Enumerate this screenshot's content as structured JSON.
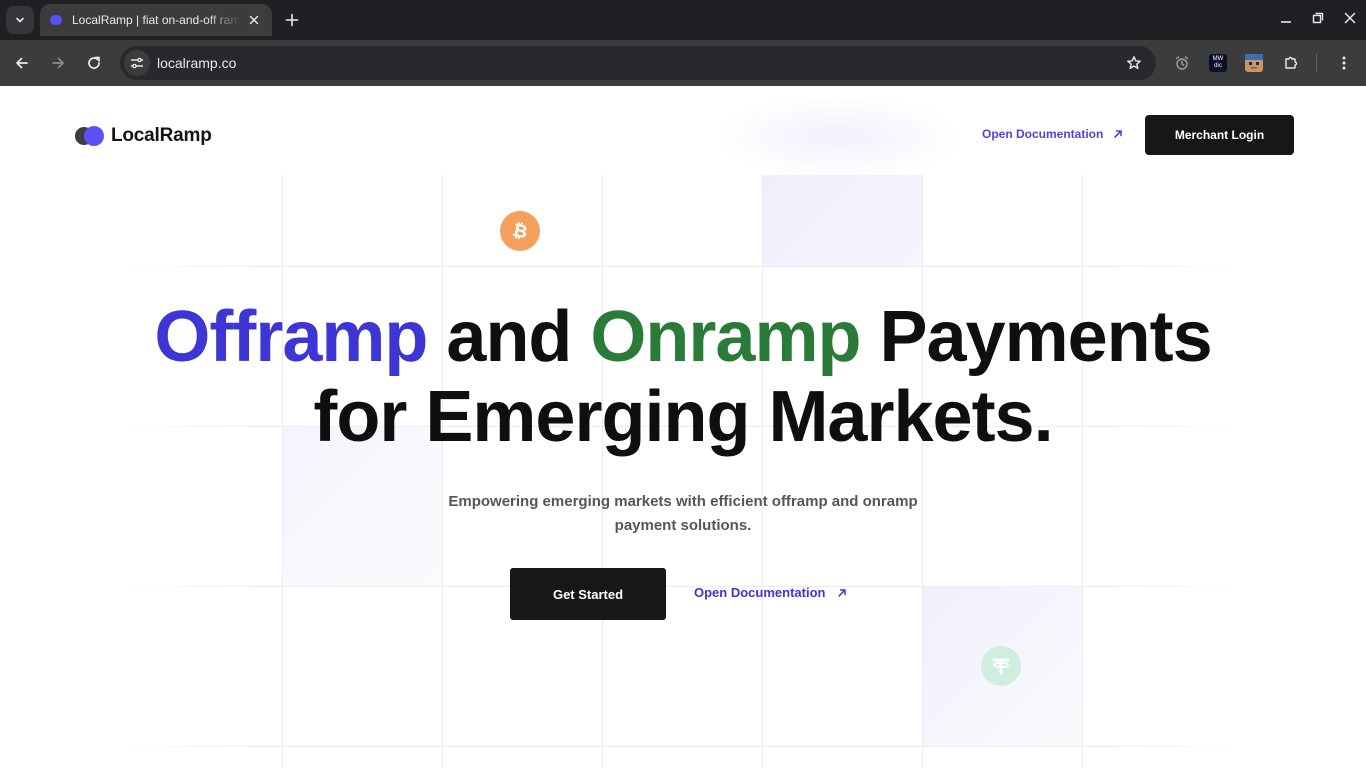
{
  "browser": {
    "tab_title": "LocalRamp | fiat on-and-off ramp",
    "url": "localramp.co",
    "extension_badge": [
      "MW",
      "dic"
    ]
  },
  "nav": {
    "brand": "LocalRamp",
    "doc_link": "Open Documentation",
    "login_button": "Merchant Login"
  },
  "hero": {
    "headline_word1": "Offramp",
    "headline_and": " and ",
    "headline_word2": "Onramp",
    "headline_rest1": " Payments",
    "headline_line2": "for Emerging Markets.",
    "subtitle": "Empowering emerging markets with efficient offramp and onramp payment solutions.",
    "cta_primary": "Get Started",
    "cta_secondary": "Open Documentation"
  },
  "colors": {
    "brand_purple": "#5b51f5",
    "headline_purple": "#3d35d4",
    "headline_green": "#2a7a3a",
    "button_dark": "#171717",
    "bitcoin_orange": "#f5a05c",
    "tether_mint": "#cfeee0"
  },
  "icons": {
    "coin_1": "bitcoin-icon",
    "coin_2": "tether-icon"
  }
}
